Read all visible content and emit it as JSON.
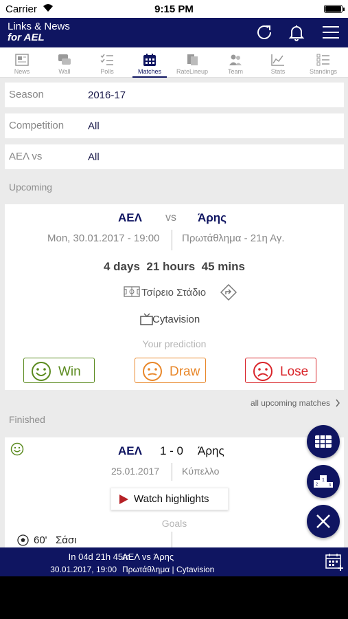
{
  "status_bar": {
    "carrier": "Carrier",
    "time": "9:15 PM"
  },
  "app": {
    "title_line1": "Links & News",
    "title_line2": "for AEL"
  },
  "tabs": [
    {
      "label": "News",
      "icon": "news-icon"
    },
    {
      "label": "Wall",
      "icon": "wall-icon"
    },
    {
      "label": "Polls",
      "icon": "polls-icon"
    },
    {
      "label": "Matches",
      "icon": "calendar-icon",
      "active": true
    },
    {
      "label": "RateLineup",
      "icon": "rate-lineup-icon"
    },
    {
      "label": "Team",
      "icon": "team-icon"
    },
    {
      "label": "Stats",
      "icon": "stats-icon"
    },
    {
      "label": "Standings",
      "icon": "standings-icon"
    }
  ],
  "filters": {
    "season": {
      "label": "Season",
      "value": "2016-17"
    },
    "competition": {
      "label": "Competition",
      "value": "All"
    },
    "opponent": {
      "label": "ΑΕΛ vs",
      "value": "All"
    }
  },
  "upcoming": {
    "section_label": "Upcoming",
    "home": "ΑΕΛ",
    "vs": "vs",
    "away": "Άρης",
    "datetime": "Mon, 30.01.2017 - 19:00",
    "competition": "Πρωτάθλημα - 21η Αγ.",
    "countdown": "4 days  21 hours  45 mins",
    "stadium": "Τσίρειο Στάδιο",
    "broadcaster": "Cytavision",
    "prediction_label": "Your prediction",
    "predictions": {
      "win": "Win",
      "draw": "Draw",
      "lose": "Lose"
    },
    "all_link": "all upcoming matches"
  },
  "finished": {
    "section_label": "Finished",
    "home": "ΑΕΛ",
    "score": "1 - 0",
    "away": "Άρης",
    "date": "25.01.2017",
    "competition": "Κύπελλο",
    "highlights": "Watch highlights",
    "goals_label": "Goals",
    "goal": {
      "minute": "60'",
      "scorer": "Σάσι"
    }
  },
  "bottom_bar": {
    "countdown": "In 04d 21h 45m",
    "match": "ΑΕΛ vs Άρης",
    "datetime": "30.01.2017, 19:00",
    "info": "Πρωτάθλημα | Cytavision"
  },
  "colors": {
    "navy": "#0f1561",
    "win": "#5a8a1e",
    "draw": "#e8872a",
    "lose": "#d9252a"
  }
}
